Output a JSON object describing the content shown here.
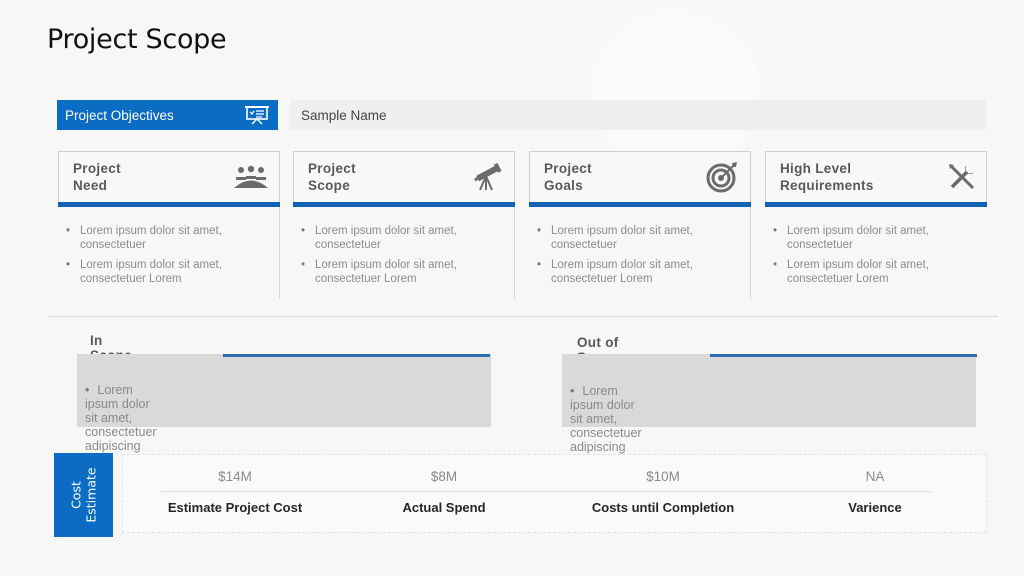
{
  "slide": {
    "title": "Project Scope"
  },
  "objectives": {
    "label": "Project Objectives",
    "icon": "presentation-board-icon",
    "value": "Sample Name"
  },
  "cards": [
    {
      "title": "Project\nNeed",
      "icon": "team-meeting-icon",
      "bullets": [
        "Lorem ipsum dolor sit amet, consectetuer",
        "Lorem ipsum dolor sit amet, consectetuer Lorem"
      ]
    },
    {
      "title": "Project\nScope",
      "icon": "telescope-icon",
      "bullets": [
        "Lorem ipsum dolor sit amet, consectetuer",
        "Lorem ipsum dolor sit amet, consectetuer Lorem"
      ]
    },
    {
      "title": "Project\nGoals",
      "icon": "target-icon",
      "bullets": [
        "Lorem ipsum dolor sit amet, consectetuer",
        "Lorem ipsum dolor sit amet, consectetuer Lorem"
      ]
    },
    {
      "title": "High Level\nRequirements",
      "icon": "tools-icon",
      "bullets": [
        "Lorem ipsum dolor sit amet, consectetuer",
        "Lorem ipsum dolor sit amet, consectetuer Lorem"
      ]
    }
  ],
  "scope": {
    "in": {
      "title": "In Scope",
      "text": "Lorem ipsum dolor sit amet, consectetuer  adipiscing elit."
    },
    "out": {
      "title": "Out of Scope",
      "text": "Lorem ipsum dolor sit amet, consectetuer  adipiscing elit."
    }
  },
  "cost": {
    "tag": "Cost\nEstimate",
    "items": [
      {
        "value": "$14M",
        "label": "Estimate Project Cost"
      },
      {
        "value": "$8M",
        "label": "Actual Spend"
      },
      {
        "value": "$10M",
        "label": "Costs until Completion"
      },
      {
        "value": "NA",
        "label": "Varience"
      }
    ]
  },
  "colors": {
    "accent": "#0a6cc2",
    "accent_bar": "#1063b5",
    "panel_gray": "#d9d9d9"
  }
}
